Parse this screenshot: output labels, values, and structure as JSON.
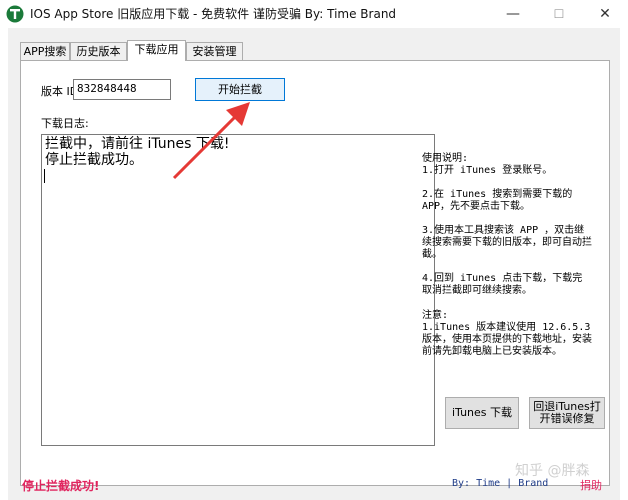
{
  "window": {
    "title": "IOS App Store 旧版应用下载 - 免费软件 谨防受骗 By: Time Brand",
    "minimize": "—",
    "maximize": "☐",
    "close": "✕"
  },
  "tabs": [
    {
      "label": "APP搜索"
    },
    {
      "label": "历史版本"
    },
    {
      "label": "下载应用"
    },
    {
      "label": "安装管理"
    }
  ],
  "download": {
    "id_label": "版本 ID:",
    "id_value": "832848448",
    "start_button": "开始拦截",
    "log_label": "下载日志:",
    "log_lines": [
      "拦截中，请前往 iTunes 下载!",
      "停止拦截成功。"
    ]
  },
  "help": {
    "title": "使用说明:",
    "step1": "1.打开 iTunes 登录账号。",
    "step2": "2.在 iTunes 搜索到需要下载的 APP，先不要点击下载。",
    "step3": "3.使用本工具搜索该 APP ，双击继续搜索需要下载的旧版本，即可自动拦截。",
    "step4": "4.回到 iTunes 点击下载，下载完取消拦截即可继续搜索。",
    "note_title": "注意:",
    "note": "1.iTunes 版本建议使用 12.6.5.3 版本，使用本页提供的下载地址，安装前请先卸载电脑上已安装版本。"
  },
  "buttons": {
    "itunes_download": "iTunes 下载",
    "restore_line1": "回退iTunes打",
    "restore_line2": "开错误修复"
  },
  "status": {
    "message": "停止拦截成功!",
    "by_text": "By: Time | Brand",
    "donate": "捐助"
  },
  "watermark": "知乎 @胖森",
  "colors": {
    "status_message": "#e0245e",
    "by_text": "#1f3c88",
    "arrow": "#e53935",
    "primary_button_border": "#0078d7"
  }
}
